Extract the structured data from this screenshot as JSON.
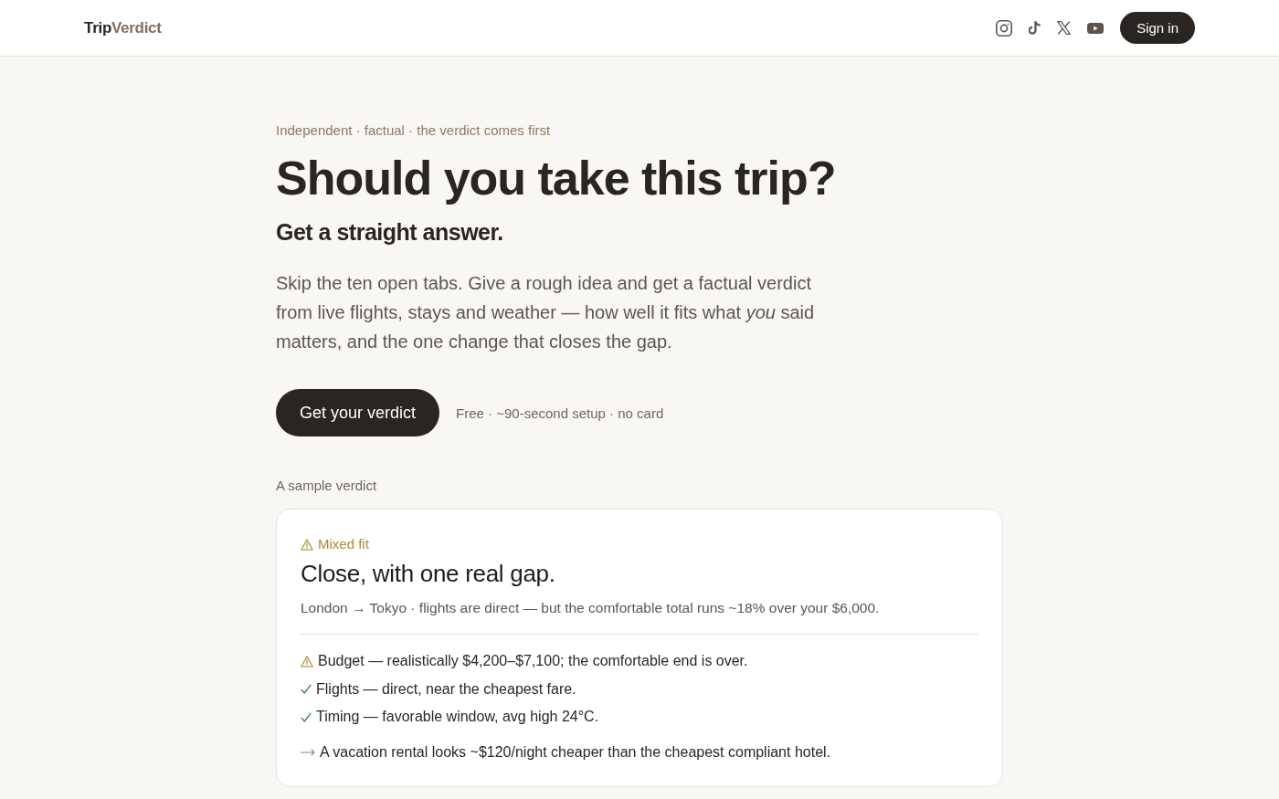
{
  "header": {
    "brand": {
      "name": "Trip",
      "accent": "Verdict"
    },
    "sign_in": "Sign in"
  },
  "hero": {
    "eyebrow": "Independent · factual · the verdict comes first",
    "title": "Should you take this trip?",
    "subtitle": "Get a straight answer.",
    "description": "Skip the ten open tabs. Give a rough idea and get a factual verdict from live flights, stays and weather — how well it fits what *you* said matters, and the one change that closes the gap.",
    "cta": "Get your verdict",
    "cta_note": "Free · ~90-second setup · no card"
  },
  "sample": {
    "label": "A sample verdict",
    "verdict": {
      "kind": "mixed",
      "badge": "Mixed fit",
      "title": "Close, with one real gap.",
      "summary": "London → Tokyo · flights are direct — but the comfortable total runs ~18% over your $6,000."
    },
    "findings": [
      {
        "kind": "warning",
        "text": "Budget — realistically $4,200–$7,100; the comfortable end is over."
      },
      {
        "kind": "pass",
        "text": "Flights — direct, near the cheapest fare."
      },
      {
        "kind": "pass",
        "text": "Timing — favorable window, avg high 24°C."
      }
    ],
    "suggestion": {
      "kind": "tip",
      "text": "A vacation rental looks ~$120/night cheaper than the cheapest compliant hotel."
    }
  }
}
